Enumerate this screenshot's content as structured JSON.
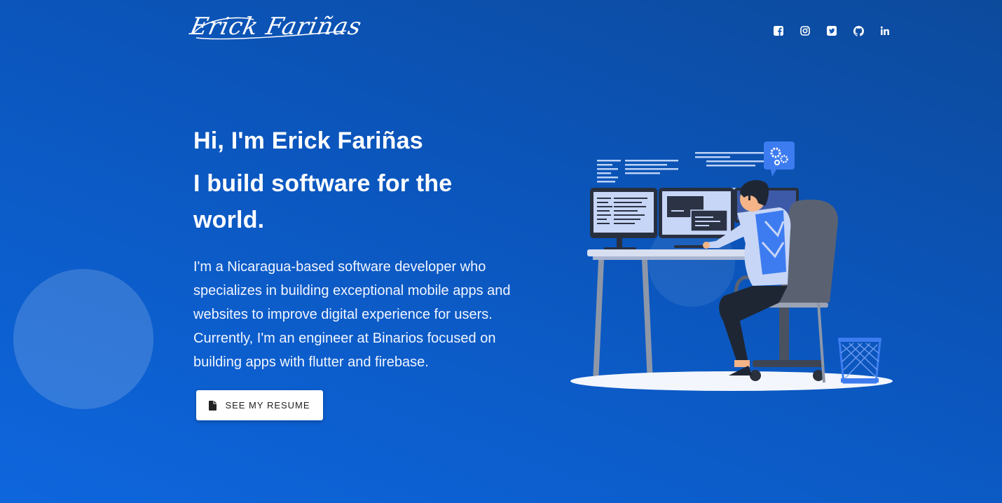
{
  "header": {
    "logo_text": "Erick Fariñas",
    "social": [
      {
        "name": "facebook",
        "icon": "facebook-square-icon"
      },
      {
        "name": "instagram",
        "icon": "instagram-icon"
      },
      {
        "name": "twitter",
        "icon": "twitter-square-icon"
      },
      {
        "name": "github",
        "icon": "github-icon"
      },
      {
        "name": "linkedin",
        "icon": "linkedin-icon"
      }
    ]
  },
  "hero": {
    "greeting": "Hi, I'm Erick Fariñas",
    "headline": "I build software for the world.",
    "bio": "I'm a Nicaragua-based software developer who specializes in building exceptional mobile apps and websites to improve digital experience for users. Currently, I'm an engineer at Binarios focused on building apps with flutter and firebase.",
    "resume_button": "SEE MY RESUME",
    "resume_icon": "file-icon"
  },
  "colors": {
    "background_top": "#0c4a9c",
    "background_bottom": "#0e66dd",
    "accent": "#3d7cf0",
    "button_bg": "#ffffff"
  }
}
